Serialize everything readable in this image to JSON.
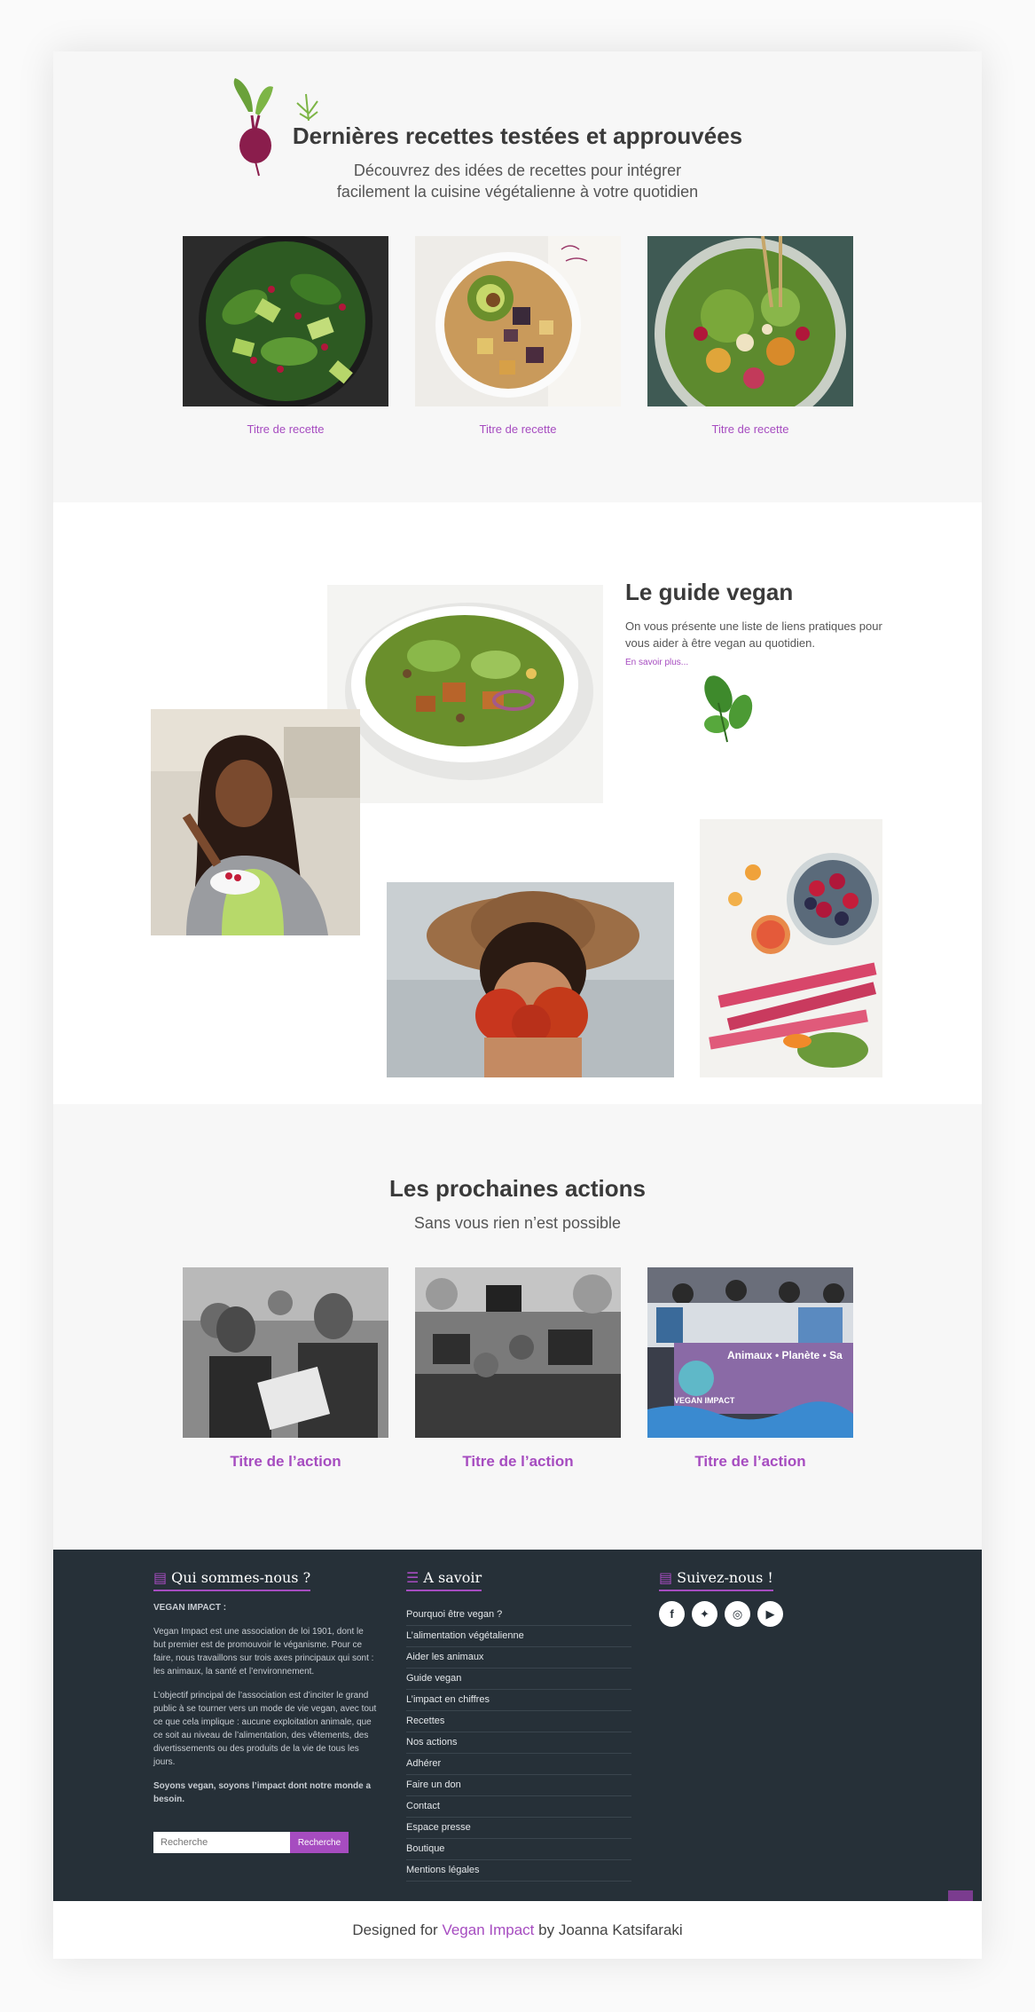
{
  "recipes": {
    "title": "Dernières recettes testées et approuvées",
    "subtitle": "Découvrez des idées de recettes pour intégrer facilement la cuisine végétalienne à votre quotidien",
    "cards": [
      {
        "label": "Titre de recette"
      },
      {
        "label": "Titre de recette"
      },
      {
        "label": "Titre de recette"
      }
    ]
  },
  "guide": {
    "title": "Le guide vegan",
    "text": "On vous présente une liste de liens pratiques pour vous aider à être vegan au quotidien.",
    "link": "En savoir plus..."
  },
  "actions": {
    "title": "Les prochaines actions",
    "subtitle": "Sans vous rien n’est possible",
    "cards": [
      {
        "label": "Titre de l’action"
      },
      {
        "label": "Titre de l’action"
      },
      {
        "label": "Titre de l’action"
      }
    ],
    "banner_text": "Animaux • Planète • Sa",
    "logo_text": "VEGAN IMPACT"
  },
  "footer": {
    "about": {
      "title": "Qui sommes-nous ?",
      "org": "VEGAN IMPACT :",
      "p1": "Vegan Impact est une association de loi 1901, dont le but premier est de promouvoir le véganisme. Pour ce faire, nous travaillons sur trois axes principaux qui sont : les animaux, la santé et l’environnement.",
      "p2": "L’objectif principal de l’association est d’inciter le grand public à se tourner vers un mode de vie vegan, avec tout ce que cela implique : aucune exploitation animale, que ce soit au niveau de l’alimentation, des vêtements, des divertissements ou des produits de la vie de tous les jours.",
      "p3": "Soyons vegan, soyons l’impact dont notre monde a besoin."
    },
    "search": {
      "placeholder": "Recherche",
      "button": "Recherche"
    },
    "links": {
      "title": "A savoir",
      "items": [
        "Pourquoi être vegan ?",
        "L’alimentation végétalienne",
        "Aider les animaux",
        "Guide vegan",
        "L’impact en chiffres",
        "Recettes",
        "Nos actions",
        "Adhérer",
        "Faire un don",
        "Contact",
        "Espace presse",
        "Boutique",
        "Mentions légales"
      ]
    },
    "social": {
      "title": "Suivez-nous !",
      "icons": [
        "facebook-icon",
        "twitter-icon",
        "instagram-icon",
        "youtube-icon"
      ]
    }
  },
  "credit": {
    "prefix": "Designed for",
    "brand": "Vegan Impact",
    "suffix": "by Joanna Katsifaraki"
  },
  "colors": {
    "accent": "#a64cc0",
    "footer_bg": "#263038"
  }
}
